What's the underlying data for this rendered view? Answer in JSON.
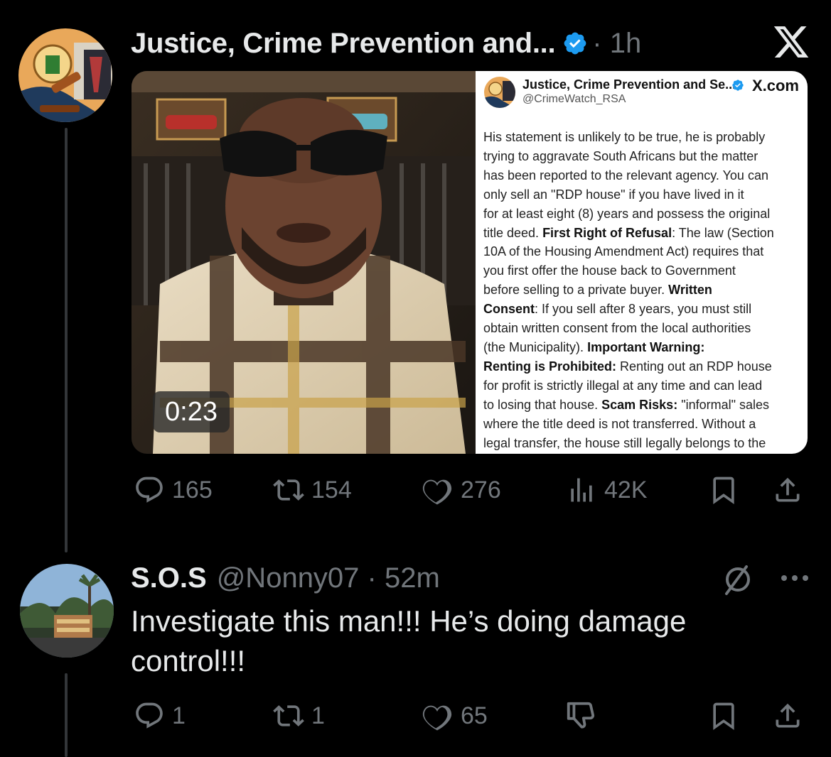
{
  "thread": {
    "x_logo": "x-logo-icon",
    "tweet1": {
      "author_name": "Justice, Crime Prevention and...",
      "verified": true,
      "time": "· 1h",
      "media": {
        "video_duration": "0:23",
        "screenshot": {
          "author_name": "Justice, Crime Prevention and Se...",
          "handle": "@CrimeWatch_RSA",
          "site": "X.com",
          "body_lines": [
            [
              {
                "t": "His statement is unlikely to be true, he is probably"
              }
            ],
            [
              {
                "t": "trying to aggravate South Africans but the matter"
              }
            ],
            [
              {
                "t": "has been reported to the relevant agency. You can"
              }
            ],
            [
              {
                "t": "only sell an \"RDP house\" if you have lived in it"
              }
            ],
            [
              {
                "t": "for at least eight (8) years and possess the original"
              }
            ],
            [
              {
                "t": "title deed. "
              },
              {
                "t": "First Right of Refusal",
                "b": true
              },
              {
                "t": ": The law (Section"
              }
            ],
            [
              {
                "t": "10A of the Housing Amendment Act) requires that"
              }
            ],
            [
              {
                "t": "you first offer the house back to Government"
              }
            ],
            [
              {
                "t": "before selling to a private buyer. "
              },
              {
                "t": "Written",
                "b": true
              }
            ],
            [
              {
                "t": "Consent",
                "b": true
              },
              {
                "t": ": If you sell after 8 years, you must still"
              }
            ],
            [
              {
                "t": "obtain written consent from the local authorities"
              }
            ],
            [
              {
                "t": "(the Municipality). "
              },
              {
                "t": "Important Warning:",
                "b": true
              }
            ],
            [
              {
                "t": "Renting is Prohibited:",
                "b": true
              },
              {
                "t": " Renting out an RDP house"
              }
            ],
            [
              {
                "t": "for profit is strictly illegal at any time and can lead"
              }
            ],
            [
              {
                "t": "to losing that house. "
              },
              {
                "t": "Scam Risks:",
                "b": true
              },
              {
                "t": " \"informal\" sales"
              }
            ],
            [
              {
                "t": "where the title deed is not transferred. Without a"
              }
            ],
            [
              {
                "t": "legal transfer, the house still legally belongs to the"
              }
            ]
          ]
        }
      },
      "actions": {
        "replies": "165",
        "reposts": "154",
        "likes": "276",
        "views": "42K"
      }
    },
    "tweet2": {
      "author_name": "S.O.S",
      "handle_time": "@Nonny07 · 52m",
      "text": "Investigate this man!!! He’s doing damage control!!!",
      "actions": {
        "replies": "1",
        "reposts": "1",
        "likes": "65"
      }
    }
  },
  "colors": {
    "background": "#000000",
    "primary_text": "#e7e9ea",
    "secondary_text": "#71767b",
    "verified_badge": "#1d9bf0",
    "thread_line": "#333639"
  }
}
